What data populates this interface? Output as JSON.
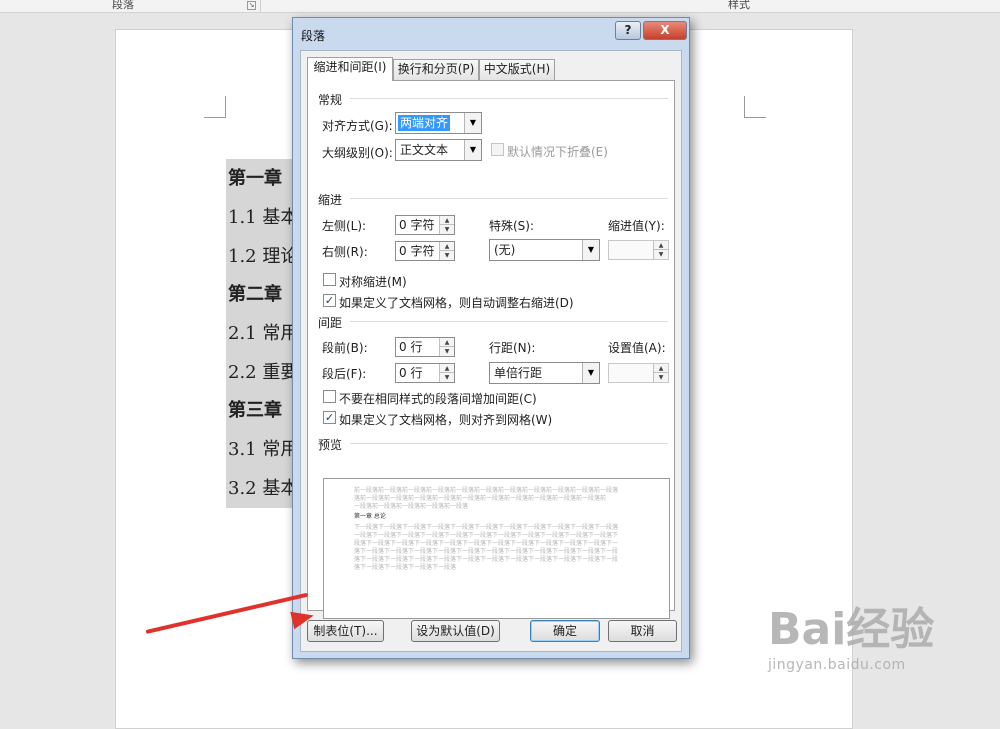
{
  "ribbon": {
    "paragraph_group": "段落",
    "styles_group": "样式"
  },
  "document": {
    "lines": [
      "第一章",
      "1.1 基本",
      "1.2 理论",
      "第二章",
      "2.1 常用",
      "2.2 重要",
      "第三章",
      "3.1 常用",
      "3.2 基本"
    ]
  },
  "dialog": {
    "title": "段落",
    "help": "?",
    "close": "X",
    "tabs": [
      "缩进和间距(I)",
      "换行和分页(P)",
      "中文版式(H)"
    ],
    "general": {
      "header": "常规",
      "alignment_label": "对齐方式(G):",
      "alignment_value": "两端对齐",
      "outline_label": "大纲级别(O):",
      "outline_value": "正文文本",
      "collapse_label": "默认情况下折叠(E)"
    },
    "indent": {
      "header": "缩进",
      "left_label": "左侧(L):",
      "left_value": "0 字符",
      "right_label": "右侧(R):",
      "right_value": "0 字符",
      "special_label": "特殊(S):",
      "special_value": "(无)",
      "by_label": "缩进值(Y):",
      "by_value": "",
      "mirror_label": "对称缩进(M)",
      "auto_adjust_label": "如果定义了文档网格，则自动调整右缩进(D)"
    },
    "spacing": {
      "header": "间距",
      "before_label": "段前(B):",
      "before_value": "0 行",
      "after_label": "段后(F):",
      "after_value": "0 行",
      "line_label": "行距(N):",
      "line_value": "单倍行距",
      "at_label": "设置值(A):",
      "at_value": "",
      "no_space_label": "不要在相同样式的段落间增加间距(C)",
      "snap_grid_label": "如果定义了文档网格，则对齐到网格(W)"
    },
    "preview": {
      "header": "预览",
      "prev_lines": [
        "前一段落前一段落前一段落前一段落前一段落前一段落前一段落前一段落前一段落前一段落前一段落",
        "落前一段落前一段落前一段落前一段落前一段落前一段落前一段落前一段落前一段落前一段落前",
        "一段落前一段落前一段落前一段落前一段落"
      ],
      "current_line": "第一章 总论",
      "next_lines": [
        "下一段落下一段落下一段落下一段落下一段落下一段落下一段落下一段落下一段落下一段落下一段落",
        "一段落下一段落下一段落下一段落下一段落下一段落下一段落下一段落下一段落下一段落下一段落下",
        "段落下一段落下一段落下一段落下一段落下一段落下一段落下一段落下一段落下一段落下一段落下一",
        "落下一段落下一段落下一段落下一段落下一段落下一段落下一段落下一段落下一段落下一段落下一段",
        "落下一段落下一段落下一段落下一段落下一段落下一段落下一段落下一段落下一段落下一段落下一段",
        "落下一段落下一段落下一段落下一段落"
      ]
    },
    "buttons": {
      "tabs": "制表位(T)...",
      "set_default": "设为默认值(D)",
      "ok": "确定",
      "cancel": "取消"
    }
  },
  "watermark": {
    "brand": "Bai经验",
    "url": "jingyan.baidu.com"
  },
  "colors": {
    "annotation_arrow": "#e0322b",
    "selection": "#3399ff",
    "title_bar": "#c9d9ee",
    "close_button": "#c7402b"
  }
}
